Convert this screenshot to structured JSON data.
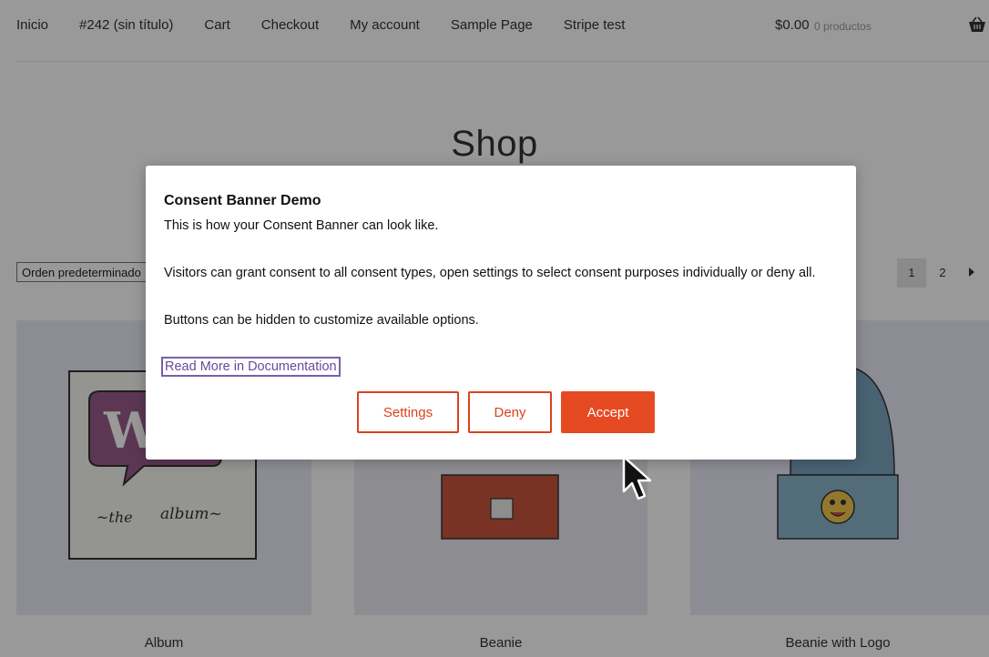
{
  "nav": {
    "items": [
      "Inicio",
      "#242 (sin título)",
      "Cart",
      "Checkout",
      "My account",
      "Sample Page",
      "Stripe test"
    ],
    "cart_amount": "$0.00",
    "cart_count": "0 productos",
    "cart_icon": "basket-icon"
  },
  "shop": {
    "title": "Shop",
    "sort_value": "Orden predeterminado",
    "pages": [
      "1",
      "2"
    ],
    "current_page": "1",
    "next_icon": "chevron-right-icon",
    "products": [
      {
        "name": "Album"
      },
      {
        "name": "Beanie"
      },
      {
        "name": "Beanie with Logo"
      }
    ]
  },
  "consent": {
    "title": "Consent Banner Demo",
    "line1": "This is how your Consent Banner can look like.",
    "line2": "Visitors can grant consent to all consent types, open settings to select consent purposes individually or deny all.",
    "line3": "Buttons can be hidden to customize available options.",
    "link": "Read More in Documentation",
    "settings_label": "Settings",
    "deny_label": "Deny",
    "accept_label": "Accept"
  },
  "colors": {
    "accent": "#e54a22",
    "link": "#6a4a9a",
    "overlay": "rgba(0,0,0,0.4)"
  }
}
